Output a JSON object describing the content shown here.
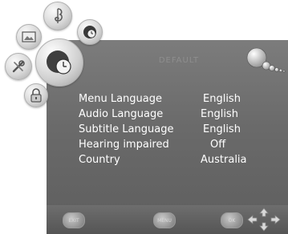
{
  "menu": {
    "title": "DEFAULT",
    "rows": [
      {
        "label": "Menu Language",
        "value": "English"
      },
      {
        "label": "Audio Language",
        "value": "English"
      },
      {
        "label": "Subtitle Language",
        "value": "English"
      },
      {
        "label": "Hearing impaired",
        "value": "Off"
      },
      {
        "label": "Country",
        "value": "Australia"
      }
    ]
  },
  "footer": {
    "exit_label": "EXIT",
    "menu_label": "MENU",
    "ok_label": "OK"
  },
  "colors": {
    "panel": "#6a6a6a",
    "text": "#ffffff",
    "bubble": "#d7d7d7"
  },
  "icons": {
    "picture": "picture-icon",
    "music": "music-icon",
    "clock": "clock-icon",
    "setup": "setup-icon",
    "lock": "lock-icon",
    "time": "time-icon",
    "decoration": "bubbles-decoration-icon",
    "navigation": "navigation-arrows-icon"
  }
}
